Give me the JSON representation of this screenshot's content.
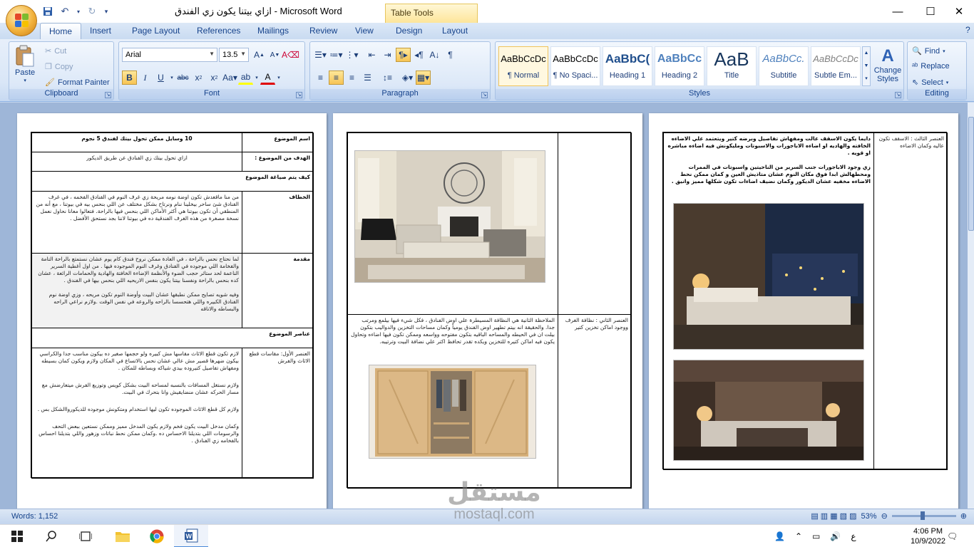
{
  "app": {
    "window_title": "ازاي بيتنا يكون زي الفندق - Microsoft Word",
    "contextual_tab_group": "Table Tools"
  },
  "tabs": [
    "Home",
    "Insert",
    "Page Layout",
    "References",
    "Mailings",
    "Review",
    "View",
    "Design",
    "Layout"
  ],
  "ribbon": {
    "clipboard": {
      "paste": "Paste",
      "cut": "Cut",
      "copy": "Copy",
      "format_painter": "Format Painter",
      "label": "Clipboard"
    },
    "font": {
      "name": "Arial",
      "size": "13.5",
      "label": "Font"
    },
    "paragraph": {
      "label": "Paragraph"
    },
    "styles": {
      "label": "Styles",
      "items": [
        {
          "sample": "AaBbCcDc",
          "name": "¶ Normal"
        },
        {
          "sample": "AaBbCcDc",
          "name": "¶ No Spaci..."
        },
        {
          "sample": "AaBbC(",
          "name": "Heading 1"
        },
        {
          "sample": "AaBbCc",
          "name": "Heading 2"
        },
        {
          "sample": "AaB",
          "name": "Title"
        },
        {
          "sample": "AaBbCc.",
          "name": "Subtitle"
        },
        {
          "sample": "AaBbCcDc",
          "name": "Subtle Em..."
        }
      ],
      "change_styles": "Change Styles"
    },
    "editing": {
      "find": "Find",
      "replace": "Replace",
      "select": "Select",
      "label": "Editing"
    }
  },
  "page1": {
    "topic_label": "اسم الموضوع",
    "topic_value": "10 وسايل ممكن تحول بيتك لفندق 5 نجوم",
    "goal_label": "الهدف من الموضوع :",
    "goal_value": "ازاي تحول بيتك زي الفنادق عن طريق الديكور",
    "how_label": "كيف يتم صياغة الموضوع",
    "speech_label": "الخطاف",
    "speech_text": "من منا ماقعدش تكون اوضة نومه مريحة زي غرف النوم في الفنادق الفخمه ، في غرف الفنادق شئ ساحر بيخلينا ننام ونرتاح بشكل مختلف عن اللي بنحس بيه في بيوتنا ، مع أنه من المنطقي أن تكون بيوتنا هي أكثر الأماكن اللي بنحس فيها بالراحة. فتعالوا معانا نحاول نعمل نسخة مصغرة من هذه الغرف الفندقية ده في بيوتنا لاننا بجد نستحق الأفضل .",
    "intro_label": "مقدمة",
    "intro_text": "لما نحتاج نحس بالراحة ، في العادة ممكن نروح فندق كام يوم عشان نستمتع بالراحة التامة والفخامة اللي موجوده في الفنادق وغرف النوم الموجوده فيها . من اول أغطية السرير الناعمة لحد ستائر حجب الضوء والأنظمة الإضاءة الخافتة والهادية والحمامات الرائعة ، عشان كده بنحس بالراحة ونفسنا بيتنا يكون بنفس الاريحيه اللي بنحس بيها في الفندق .",
    "intro_text2": "وفيه شويه تصايح ممكن نطبقها عشان البيت وأوضة النوم تكون مريحه ، وزي اوضة نوم الفنادق الكبيره واللي هتحسسا بالراحه والروعه في نفس الوقت .ولازم نراعي الراحه والبساطه والاناقه",
    "elements_label": "عناصر الموضوع",
    "el1_label": "العنصر الأول: مقاسات قطع الاثاث والفرش",
    "el1_text1": "لازم تكون قطع الاثاث مقاسها مش كبيره ولو حجمها صغير ده بيكون مناسب جدا والكراسي بيكون ضهرها قصير مش عالي عشان نحس بالاتساع في المكان ولازم ويكون كمان بسيطه ومفهاش تفاصيل كتيروده بيدي شياكه وبساطه للمكان .",
    "el1_text2": "ولازم نستغل المسافات بالنسبه لمساحه البيت بشكل كويس وتوزيع الفرش ميتعارضش مع مسار الحركه عشان منضايقيش وانا بتحرك في البيت.",
    "el1_text3": "ولازم كل قطع الاثاث الموجوده تكون ليها استخدام ومتكونش موجوده للديكورواالشكل بس .",
    "el1_text4": "وكمان مدخل البيت يكون فخم ولازم يكون المدخل مميز وممكن نستعين ببعض التحف والرسومات اللي بتديلنا الاحساس ده .وكمان ممكن نحط نباتات وزهور واللي بتديلنا احساس بالفخامه زي الفنادق ."
  },
  "page2": {
    "el2_label": "العنصر الثاني : نظافة الغرف ووجود اماكن تخزين كتير",
    "el2_text": "الملاحظة الثانية هي النظافة المسيطرة علي اوض الفنادق ، فكل شيء فيها بيلمع ومرتب جدا. والحقيقة انه بيتم تطهير اوض الفندق يومياً وكمان مساحات التخزين والدواليب بتكون بيلت ان في الحيطه والمساحه الباقيه بتكون مفتوحه وواسعه وممكن تكون فيها اضاءه وتحاول يكون فيه اماكن كتيره للتخزين ويكده تقدر تحافظ اكتر علي نضافة البيت وترتيبه."
  },
  "page3": {
    "el3_label": "العنصر الثالث : الاسقف تكون عاليه وكمان الاضاءه",
    "el3_text1": "دايما يكون الاسقف عالت ومفهاش تفاصيل وبرضه كتير ويتعتمد علي الاضاءه الخافته والهاديه او اضاءه الاباجورات والاسبوتات ومليكونش فيه اضاءه مباشره او قويه .",
    "el3_text2": "زي وجود الاباجورات جنب السرير من الناحيتين واسبوتات في الممرات ومحطهالش ابدا فوق مكان النوم عشان متاذيش العين و كمان ممكن نحط الاضاءه مخفيه عشان الديكور وكمان نضيف اضاءات تكون شكلها مميز وانيق ."
  },
  "status": {
    "words": "Words: 1,152",
    "zoom": "53%"
  },
  "taskbar": {
    "time": "4:06 PM",
    "date": "10/9/2022",
    "lang": "ع"
  },
  "watermark": {
    "arabic": "مستقل",
    "latin": "mostaql.com"
  }
}
